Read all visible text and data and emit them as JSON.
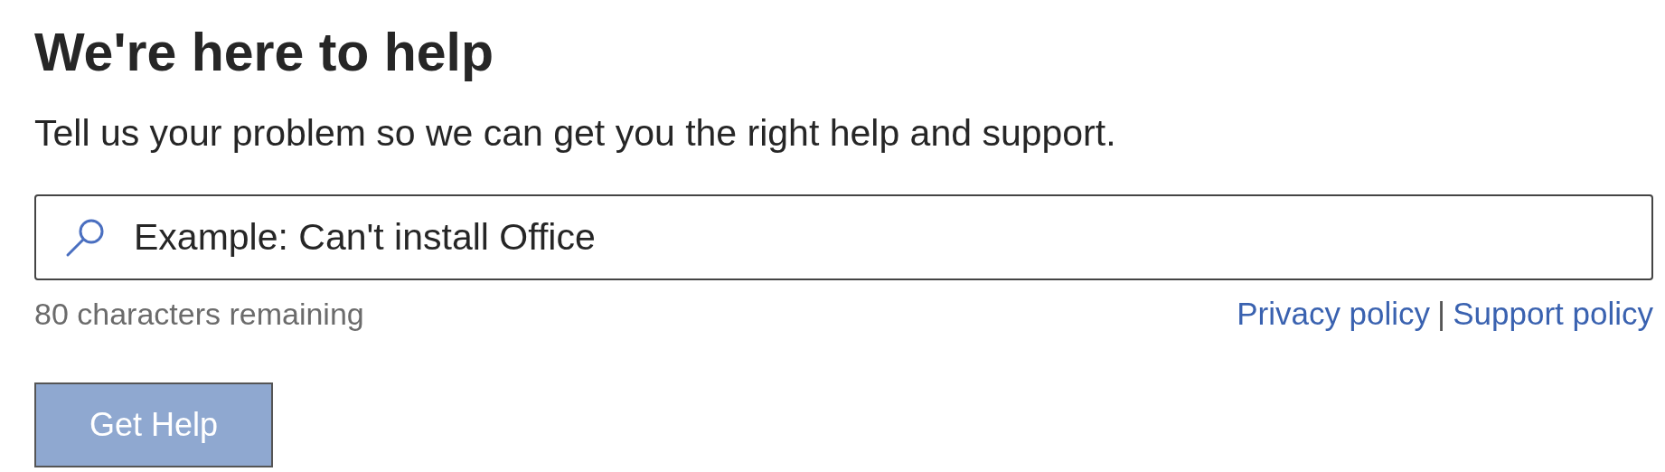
{
  "heading": "We're here to help",
  "subtitle": "Tell us your problem so we can get you the right help and support.",
  "search": {
    "placeholder": "Example: Can't install Office"
  },
  "counter": "80 characters remaining",
  "links": [
    {
      "label": "Privacy policy"
    },
    {
      "label": "Support policy"
    }
  ],
  "separator": "|",
  "button": {
    "label": "Get Help",
    "disabled": true
  }
}
